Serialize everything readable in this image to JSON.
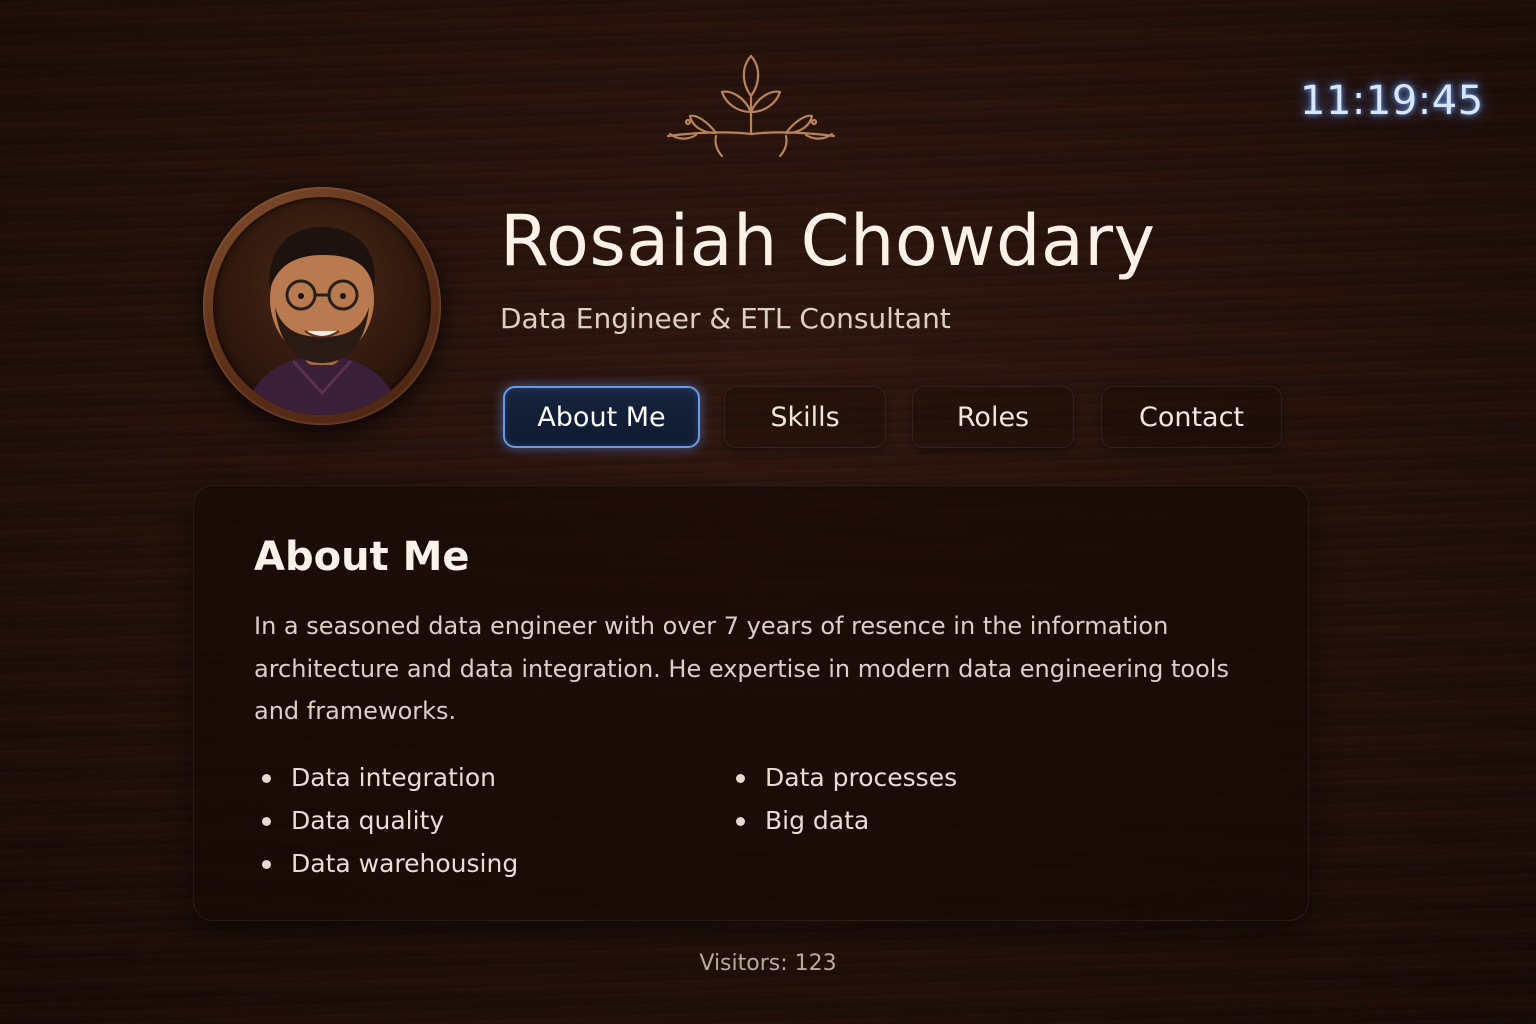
{
  "clock": {
    "time": "11:19:45"
  },
  "profile": {
    "name": "Rosaiah Chowdary",
    "title": "Data Engineer & ETL Consultant",
    "avatar_icon": "profile-photo"
  },
  "nav": {
    "tabs": [
      {
        "label": "About Me",
        "active": true
      },
      {
        "label": "Skills",
        "active": false
      },
      {
        "label": "Roles",
        "active": false
      },
      {
        "label": "Contact",
        "active": false
      }
    ]
  },
  "about": {
    "heading": "About Me",
    "paragraph": "In a seasoned data engineer with over 7 years of resence in the information architecture and data integration. He expertise in modern data engineering tools and frameworks.",
    "list_left": [
      "Data integration",
      "Data quality",
      "Data warehousing"
    ],
    "list_right": [
      "Data processes",
      "Big data"
    ]
  },
  "footer": {
    "visitors": "Visitors: 123"
  },
  "colors": {
    "accent_blue": "#6b9ae0",
    "clock_glow": "#78aaff",
    "ornament": "#b9825a",
    "background": "#22100a"
  }
}
